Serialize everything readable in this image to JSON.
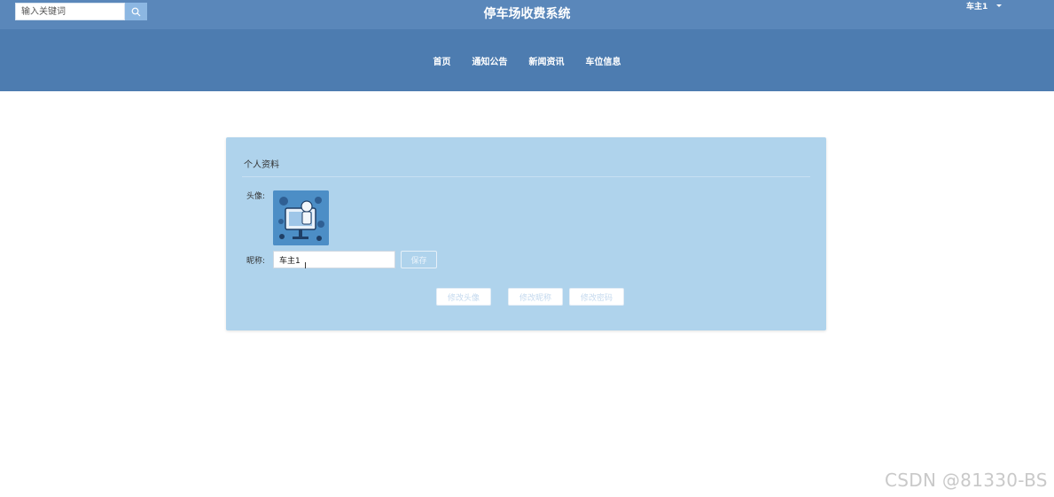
{
  "header": {
    "search": {
      "placeholder": "输入关键词",
      "value": ""
    },
    "title": "停车场收费系统",
    "user": {
      "name": "车主1"
    }
  },
  "nav": {
    "items": [
      {
        "label": "首页"
      },
      {
        "label": "通知公告"
      },
      {
        "label": "新闻资讯"
      },
      {
        "label": "车位信息"
      }
    ]
  },
  "profile": {
    "title": "个人资料",
    "avatar_label": "头像:",
    "nickname_label": "昵称:",
    "nickname_value": "车主1",
    "save_label": "保存",
    "actions": {
      "change_avatar": "修改头像",
      "change_nickname": "修改昵称",
      "change_password": "修改密码"
    }
  },
  "watermark": "CSDN @81330-BS",
  "colors": {
    "topbar": "#5a87ba",
    "navbar": "#4d7cb0",
    "card": "#afd3ec",
    "search_button": "#8cb7e2"
  },
  "icons": {
    "search": "search-icon",
    "caret": "caret-down-icon",
    "cursor": "text-cursor-icon"
  }
}
